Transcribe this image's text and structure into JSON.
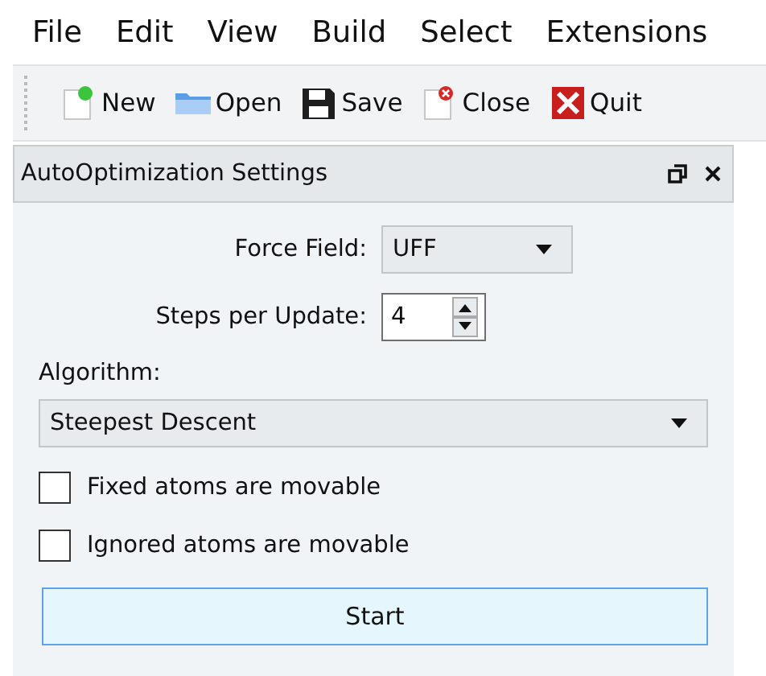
{
  "menu_bar": [
    "File",
    "Edit",
    "View",
    "Build",
    "Select",
    "Extensions"
  ],
  "toolbar": [
    {
      "kind": "new",
      "label": "New"
    },
    {
      "kind": "open",
      "label": "Open"
    },
    {
      "kind": "save",
      "label": "Save"
    },
    {
      "kind": "close",
      "label": "Close"
    },
    {
      "kind": "quit",
      "label": "Quit"
    }
  ],
  "panel": {
    "title": "AutoOptimization Settings",
    "force_field": {
      "label": "Force Field:",
      "value": "UFF"
    },
    "steps": {
      "label": "Steps per Update:",
      "value": "4"
    },
    "algorithm": {
      "label": "Algorithm:",
      "value": "Steepest Descent"
    },
    "options": [
      {
        "label": "Fixed atoms are movable",
        "checked": false
      },
      {
        "label": "Ignored atoms are movable",
        "checked": false
      }
    ],
    "start_button": "Start"
  }
}
